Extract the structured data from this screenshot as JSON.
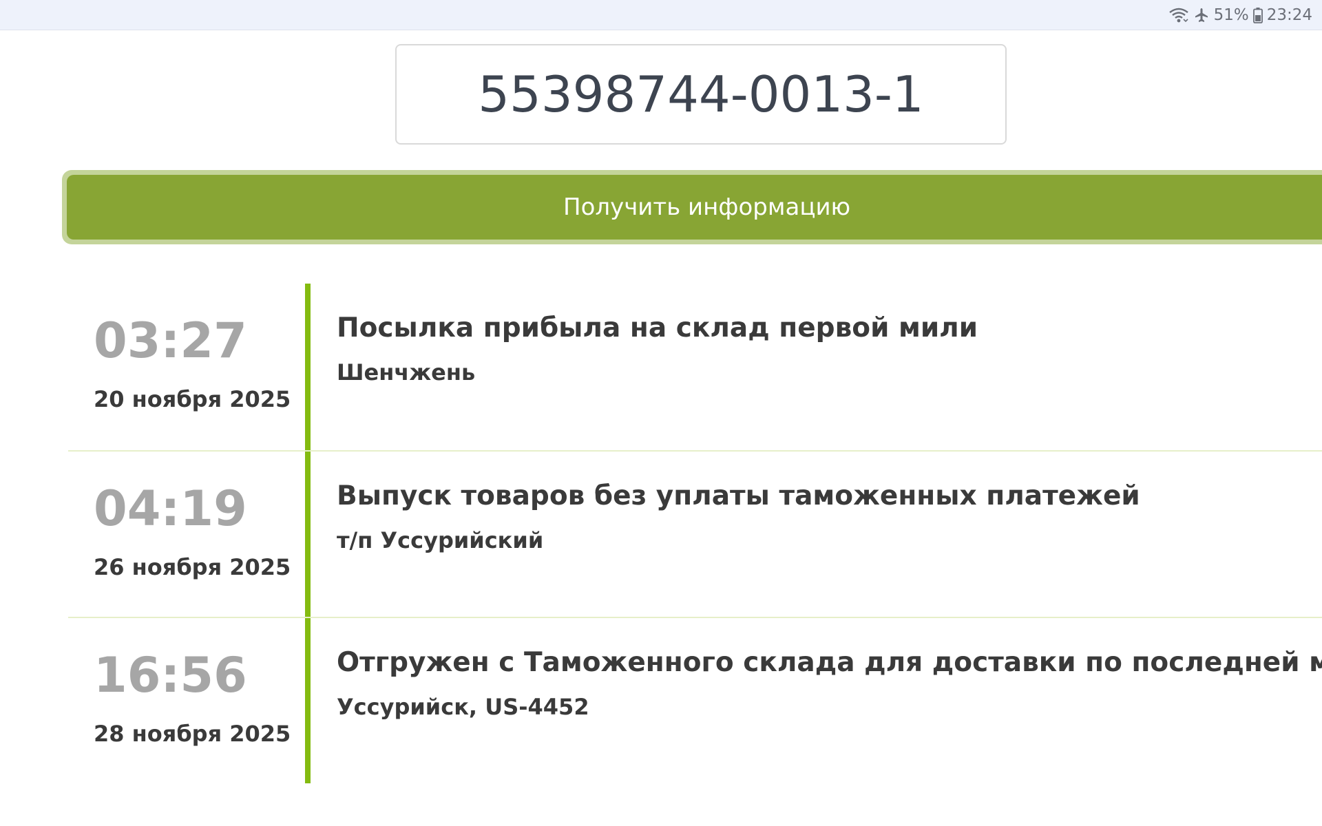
{
  "status_bar": {
    "battery": "51%",
    "time": "23:24",
    "icons": [
      "wifi-icon",
      "airplane-mode-icon",
      "battery-icon"
    ]
  },
  "tracking": {
    "number": "55398744-0013-1"
  },
  "get_info_button": {
    "label": "Получить информацию"
  },
  "events": [
    {
      "time": "03:27",
      "date": "20 ноября 2025",
      "title": "Посылка прибыла на склад первой мили",
      "place": "Шенчжень"
    },
    {
      "time": "04:19",
      "date": "26 ноября 2025",
      "title": "Выпуск товаров без уплаты таможенных платежей",
      "place": "т/п Уссурийский"
    },
    {
      "time": "16:56",
      "date": "28 ноября 2025",
      "title": "Отгружен с Таможенного склада для доставки по последней миле",
      "place": "Уссурийск, US-4452"
    }
  ],
  "colors": {
    "accent_green": "#88a534",
    "timeline_green": "#84bb10",
    "button_border": "#c4d49a",
    "time_gray": "#a6a6a6",
    "text_dark": "#3a3a3a"
  }
}
